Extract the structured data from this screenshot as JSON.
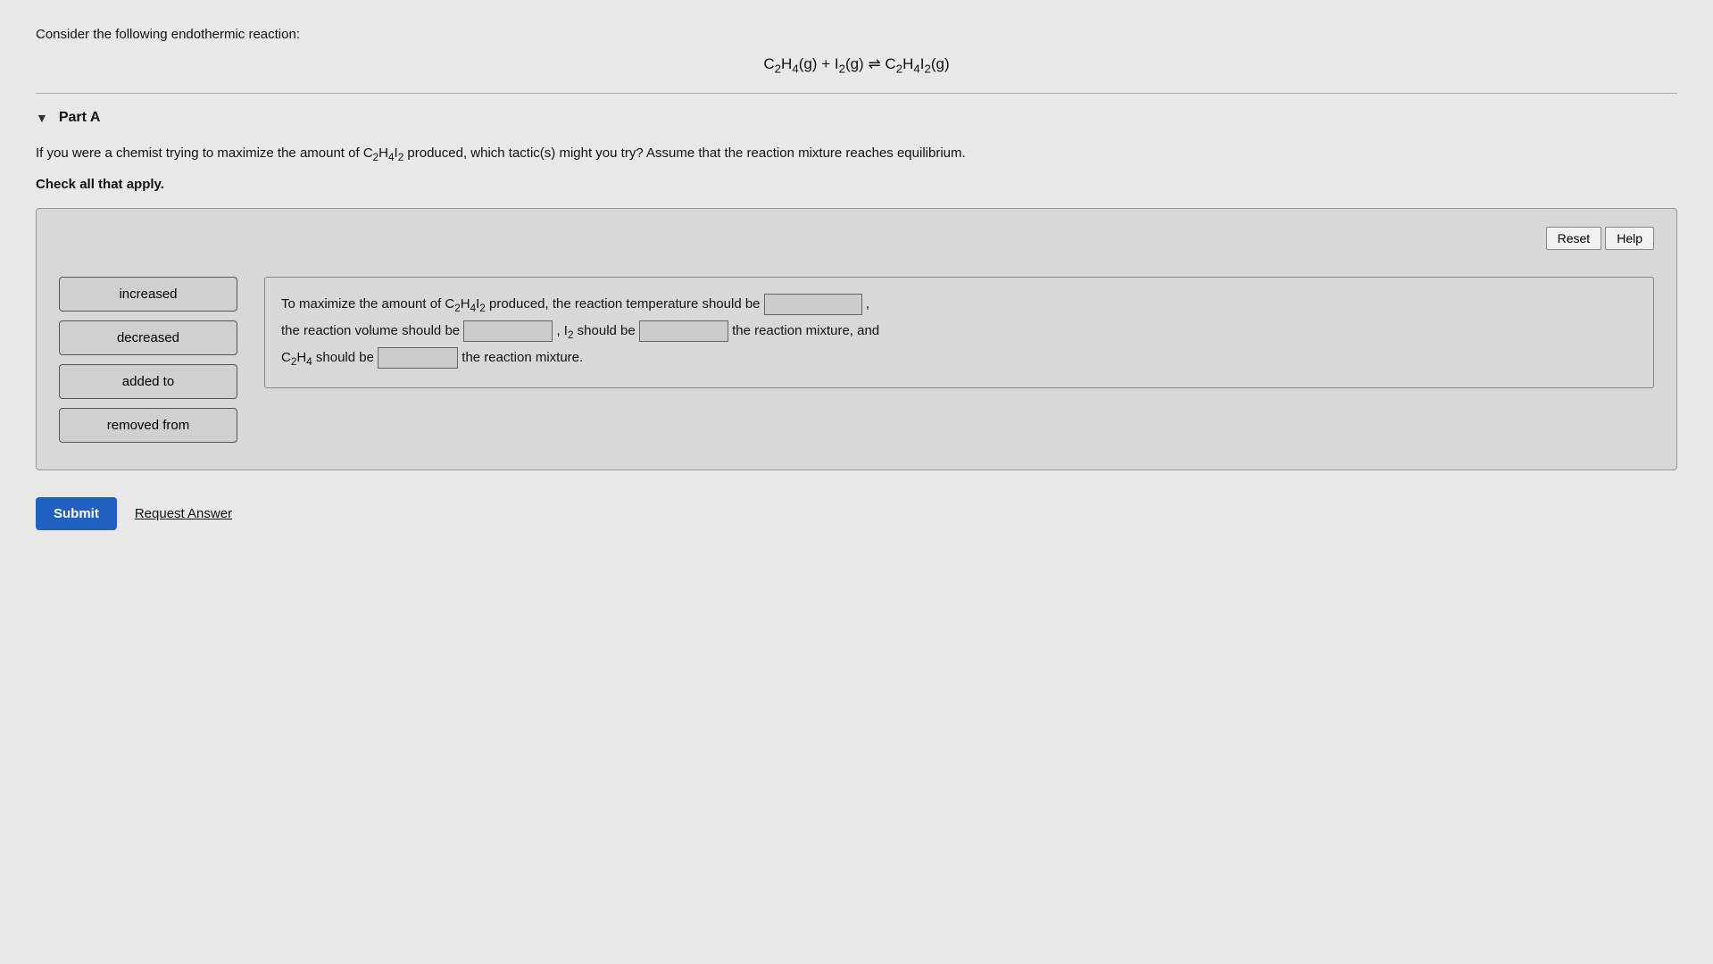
{
  "page": {
    "intro": "Consider the following endothermic reaction:",
    "equation": "C₂H₄(g) + I₂(g) ⇌ C₂H₄I₂(g)",
    "part_label": "Part A",
    "question": "If you were a chemist trying to maximize the amount of C₂H₄I₂ produced, which tactic(s) might you try? Assume that the reaction mixture reaches equilibrium.",
    "check_all": "Check all that apply.",
    "buttons": {
      "reset": "Reset",
      "help": "Help",
      "submit": "Submit",
      "request_answer": "Request Answer"
    },
    "choices": [
      {
        "label": "increased",
        "id": "increased"
      },
      {
        "label": "decreased",
        "id": "decreased"
      },
      {
        "label": "added to",
        "id": "added-to"
      },
      {
        "label": "removed from",
        "id": "removed-from"
      }
    ],
    "fill_text": {
      "line1_prefix": "To maximize the amount of C₂H₄I₂ produced, the reaction temperature should be",
      "line1_suffix": ",",
      "line2_prefix": "the reaction volume should be",
      "line2_middle": ", I₂ should be",
      "line2_suffix": "the reaction mixture, and",
      "line3_prefix": "C₂H₄ should be",
      "line3_suffix": "the reaction mixture."
    }
  }
}
